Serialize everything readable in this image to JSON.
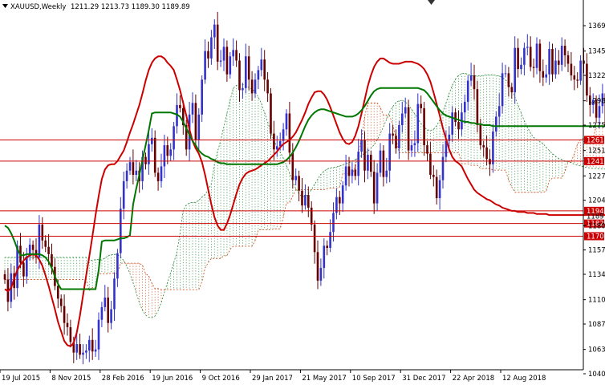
{
  "window": {
    "symbol_label": "XAUUSD,Weekly",
    "ohlc_label": "1211.29 1213.73 1189.30 1189.89"
  },
  "chart_data": {
    "type": "candlestick",
    "symbol": "XAUUSD",
    "timeframe": "Weekly",
    "ohlc": {
      "open": 1211.29,
      "high": 1213.73,
      "low": 1189.3,
      "close": 1189.89
    },
    "ylim": [
      1040,
      1382
    ],
    "y_ticks": [
      1369,
      1345,
      1322,
      1298,
      1275,
      1251,
      1227,
      1204,
      1180,
      1157,
      1134,
      1110,
      1087,
      1063,
      1040
    ],
    "x_ticks": [
      "19 Jul 2015",
      "8 Nov 2015",
      "28 Feb 2016",
      "19 Jun 2016",
      "9 Oct 2016",
      "29 Jan 2017",
      "21 May 2017",
      "10 Sep 2017",
      "31 Dec 2017",
      "22 Apr 2018",
      "12 Aug 2018"
    ],
    "x_tick_week_index": [
      0,
      16,
      32,
      48,
      64,
      80,
      96,
      112,
      128,
      144,
      160
    ],
    "horizontal_levels": [
      {
        "value": 1261,
        "label": "1261"
      },
      {
        "value": 1241,
        "label": "1241"
      },
      {
        "value": 1194,
        "label": "1194"
      },
      {
        "value": 1182,
        "label": "1182"
      },
      {
        "value": 1170,
        "label": "1170"
      }
    ],
    "current_price_label": "1189",
    "candle_closes": [
      1129,
      1108,
      1135,
      1121,
      1161,
      1145,
      1132,
      1151,
      1162,
      1157,
      1150,
      1181,
      1166,
      1160,
      1153,
      1141,
      1123,
      1111,
      1104,
      1088,
      1084,
      1070,
      1060,
      1068,
      1058,
      1060,
      1062,
      1072,
      1061,
      1063,
      1091,
      1103,
      1112,
      1088,
      1101,
      1130,
      1154,
      1196,
      1222,
      1232,
      1240,
      1228,
      1232,
      1222,
      1245,
      1238,
      1257,
      1263,
      1230,
      1222,
      1236,
      1256,
      1246,
      1252,
      1274,
      1294,
      1291,
      1275,
      1252,
      1285,
      1296,
      1261,
      1285,
      1318,
      1345,
      1338,
      1358,
      1370,
      1335,
      1336,
      1349,
      1323,
      1340,
      1346,
      1336,
      1308,
      1310,
      1340,
      1318,
      1305,
      1318,
      1327,
      1337,
      1318,
      1305,
      1267,
      1252,
      1255,
      1260,
      1271,
      1286,
      1249,
      1223,
      1227,
      1213,
      1199,
      1209,
      1197,
      1181,
      1155,
      1128,
      1140,
      1161,
      1159,
      1174,
      1192,
      1207,
      1201,
      1218,
      1236,
      1227,
      1233,
      1227,
      1250,
      1261,
      1232,
      1247,
      1231,
      1201,
      1230,
      1251,
      1226,
      1232,
      1267,
      1265,
      1253,
      1275,
      1286,
      1292,
      1251,
      1256,
      1258,
      1295,
      1291,
      1256,
      1248,
      1228,
      1226,
      1206,
      1223,
      1245,
      1260,
      1266,
      1287,
      1278,
      1271,
      1287,
      1297,
      1317,
      1322,
      1309,
      1275,
      1256,
      1254,
      1243,
      1238,
      1269,
      1283,
      1293,
      1324,
      1324,
      1311,
      1306,
      1348,
      1328,
      1332,
      1348,
      1349,
      1330,
      1329,
      1352,
      1326,
      1320,
      1323,
      1347,
      1323,
      1336,
      1332,
      1350,
      1341,
      1333,
      1322,
      1318,
      1317,
      1336,
      1333,
      1303,
      1294,
      1299,
      1282,
      1293,
      1305,
      1275,
      1269,
      1255,
      1253,
      1237,
      1223,
      1218,
      1212,
      1210,
      1209,
      1200,
      1194,
      1190
    ],
    "series": [
      {
        "name": "Tenkan-sen",
        "color": "#cc0000",
        "values": [
          1120,
          1118,
          1121,
          1130,
          1138,
          1143,
          1147,
          1150,
          1152,
          1153,
          1152,
          1148,
          1142,
          1133,
          1123,
          1112,
          1101,
          1089,
          1080,
          1071,
          1067,
          1066,
          1069,
          1079,
          1095,
          1114,
          1133,
          1151,
          1170,
          1190,
          1208,
          1224,
          1233,
          1237,
          1238,
          1238,
          1241,
          1246,
          1251,
          1259,
          1268,
          1276,
          1285,
          1294,
          1305,
          1317,
          1327,
          1334,
          1338,
          1340,
          1340,
          1338,
          1334,
          1331,
          1327,
          1318,
          1308,
          1296,
          1284,
          1271,
          1260,
          1253,
          1248,
          1240,
          1228,
          1214,
          1200,
          1188,
          1180,
          1176,
          1176,
          1182,
          1190,
          1200,
          1210,
          1219,
          1225,
          1229,
          1231,
          1232,
          1233,
          1235,
          1237,
          1239,
          1241,
          1244,
          1247,
          1250,
          1254,
          1257,
          1259,
          1261,
          1264,
          1268,
          1274,
          1280,
          1287,
          1295,
          1301,
          1306,
          1307,
          1307,
          1304,
          1299,
          1292,
          1284,
          1276,
          1268,
          1262,
          1258,
          1257,
          1259,
          1265,
          1274,
          1286,
          1299,
          1312,
          1322,
          1330,
          1335,
          1338,
          1338,
          1336,
          1334,
          1333,
          1333,
          1333,
          1334,
          1335,
          1335,
          1335,
          1334,
          1333,
          1331,
          1328,
          1323,
          1316,
          1306,
          1295,
          1284,
          1272,
          1262,
          1252,
          1245,
          1241,
          1239,
          1236,
          1230,
          1224,
          1219,
          1214,
          1211,
          1209,
          1207,
          1205,
          1204,
          1202,
          1200,
          1199,
          1197,
          1196,
          1195,
          1194,
          1194,
          1193,
          1193,
          1193,
          1192,
          1192,
          1192,
          1191,
          1191,
          1191,
          1191,
          1190,
          1190,
          1190,
          1190,
          1190,
          1190,
          1190,
          1190,
          1190,
          1190,
          1190,
          1190,
          1190,
          1190,
          1190,
          1190,
          1190,
          1190,
          1190,
          1190,
          1190,
          1190,
          1190,
          1190,
          1190,
          1190,
          1190,
          1190,
          1190,
          1190
        ]
      },
      {
        "name": "Kijun-sen",
        "color": "#007700",
        "values": [
          1180,
          1178,
          1173,
          1166,
          1158,
          1152,
          1152,
          1153,
          1153,
          1153,
          1153,
          1153,
          1152,
          1150,
          1146,
          1140,
          1132,
          1125,
          1120,
          1120,
          1120,
          1120,
          1120,
          1120,
          1120,
          1120,
          1120,
          1120,
          1120,
          1120,
          1138,
          1165,
          1166,
          1166,
          1166,
          1166,
          1167,
          1168,
          1168,
          1169,
          1171,
          1200,
          1215,
          1228,
          1242,
          1256,
          1270,
          1286,
          1287,
          1287,
          1287,
          1287,
          1287,
          1287,
          1286,
          1285,
          1283,
          1278,
          1272,
          1266,
          1260,
          1256,
          1251,
          1248,
          1246,
          1245,
          1243,
          1242,
          1240,
          1239,
          1239,
          1238,
          1238,
          1238,
          1238,
          1238,
          1238,
          1238,
          1238,
          1238,
          1238,
          1238,
          1238,
          1238,
          1238,
          1238,
          1238,
          1238,
          1239,
          1240,
          1242,
          1245,
          1249,
          1254,
          1260,
          1267,
          1274,
          1280,
          1284,
          1287,
          1289,
          1290,
          1290,
          1289,
          1288,
          1287,
          1286,
          1285,
          1284,
          1283,
          1283,
          1283,
          1284,
          1286,
          1289,
          1293,
          1298,
          1303,
          1307,
          1309,
          1310,
          1310,
          1310,
          1310,
          1310,
          1310,
          1310,
          1310,
          1310,
          1310,
          1310,
          1310,
          1310,
          1309,
          1308,
          1305,
          1301,
          1297,
          1293,
          1289,
          1286,
          1284,
          1283,
          1282,
          1281,
          1280,
          1279,
          1278,
          1278,
          1277,
          1277,
          1276,
          1276,
          1275,
          1275,
          1275,
          1274,
          1274,
          1274,
          1274,
          1274,
          1274,
          1274,
          1274,
          1274,
          1274,
          1274,
          1274,
          1274,
          1274,
          1274,
          1274,
          1274,
          1274,
          1274,
          1274,
          1274,
          1274,
          1274,
          1274,
          1274,
          1274,
          1274,
          1274,
          1274,
          1274,
          1274,
          1274,
          1274,
          1274,
          1274,
          1274,
          1274,
          1274,
          1274,
          1274,
          1274,
          1274,
          1274,
          1274,
          1274
        ]
      }
    ]
  },
  "colors": {
    "bull_candle": "#3333cc",
    "bear_candle": "#660000",
    "level_line": "#cc0000",
    "cloud_bull": "#228833",
    "cloud_bear": "#cc4411",
    "axis": "#000000"
  },
  "icons": [
    "dropdown-triangle-icon",
    "drag-marker-icon"
  ]
}
